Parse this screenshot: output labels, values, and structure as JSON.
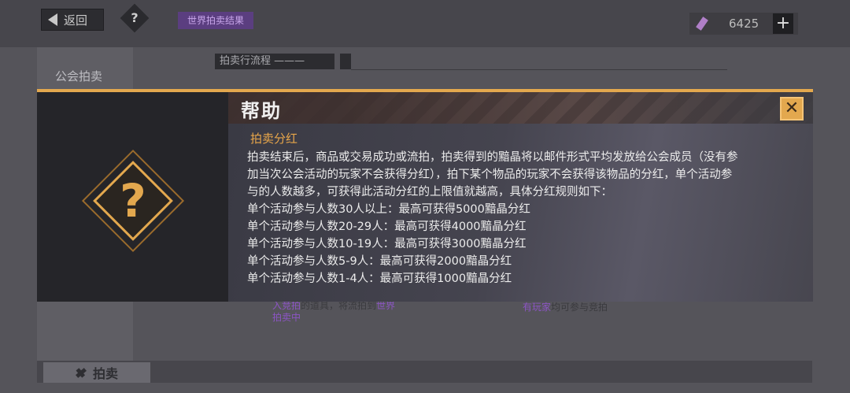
{
  "header": {
    "back_label": "返回",
    "help_label": "?",
    "world_tag": "世界拍卖结果",
    "currency_value": "6425",
    "plus_label": "+"
  },
  "sidebar": {
    "title": "公会拍卖"
  },
  "main": {
    "flow_label": "拍卖行流程 ———",
    "under_text_1a": "入竞拍",
    "under_text_1b": "的道具，将流拍到",
    "under_text_1c": "世界",
    "under_text_1d": "拍卖中",
    "under_text_2a": "有玩家",
    "under_text_2b": "均可参与竞拍"
  },
  "bottom_tab": {
    "label": "拍卖"
  },
  "modal": {
    "title": "帮助",
    "close_label": "✕",
    "icon_char": "?",
    "section_title": "拍卖分红",
    "lines": [
      "拍卖结束后，商品或交易成功或流拍，拍卖得到的黯晶将以邮件形式平均发放给公会成员（没有参",
      "加当次公会活动的玩家不会获得分红），拍下某个物品的玩家不会获得该物品的分红，单个活动参",
      "与的人数越多，可获得此活动分红的上限值就越高，具体分红规则如下：",
      "单个活动参与人数30人以上：最高可获得5000黯晶分红",
      "单个活动参与人数20-29人：最高可获得4000黯晶分红",
      "单个活动参与人数10-19人：最高可获得3000黯晶分红",
      "单个活动参与人数5-9人：最高可获得2000黯晶分红",
      "单个活动参与人数1-4人：最高可获得1000黯晶分红"
    ]
  },
  "colors": {
    "accent": "#e3a84e",
    "purple_tag": "#5b3e80",
    "modal_bg": "#1f1f24"
  }
}
